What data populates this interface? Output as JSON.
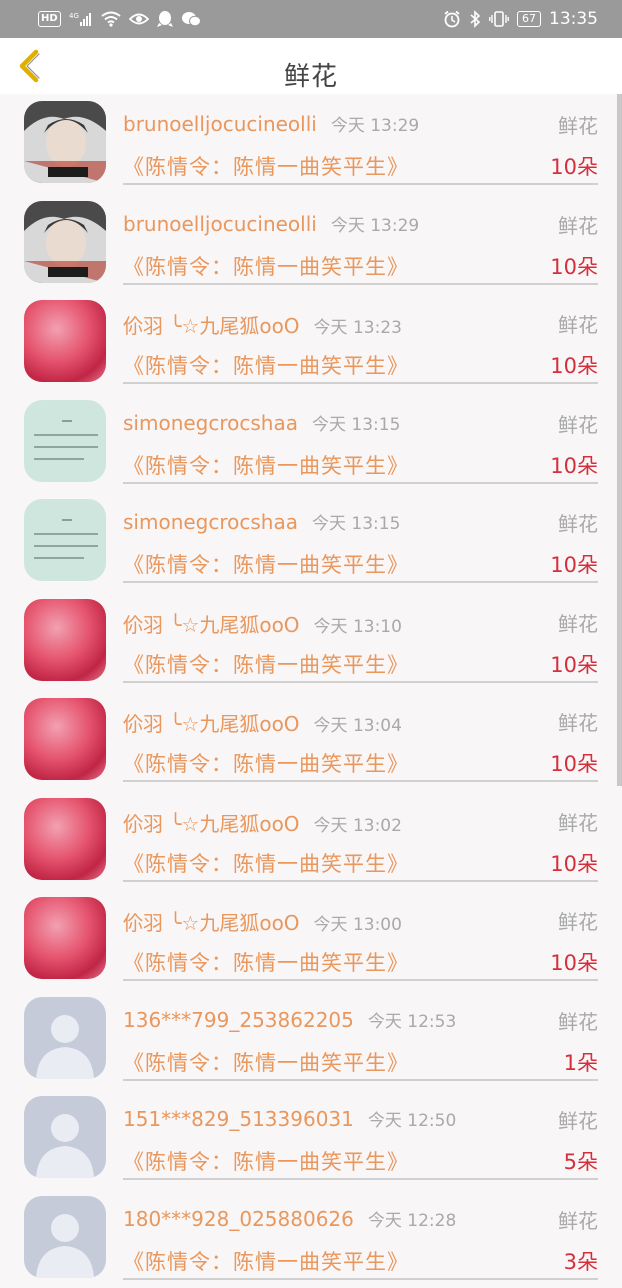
{
  "status_bar": {
    "hd": "HD",
    "network": "4G",
    "battery": "67",
    "time": "13:35"
  },
  "header": {
    "title": "鲜花"
  },
  "rows": [
    {
      "avatar": "photo-boy",
      "name": "brunoelljocucineolli",
      "time": "今天 13:29",
      "gift": "鲜花",
      "work": "《陈情令：陈情一曲笑平生》",
      "count": "10朵"
    },
    {
      "avatar": "photo-boy",
      "name": "brunoelljocucineolli",
      "time": "今天 13:29",
      "gift": "鲜花",
      "work": "《陈情令：陈情一曲笑平生》",
      "count": "10朵"
    },
    {
      "avatar": "pink-art",
      "name": "伱羽 ╰☆九尾狐ooO",
      "time": "今天 13:23",
      "gift": "鲜花",
      "work": "《陈情令：陈情一曲笑平生》",
      "count": "10朵"
    },
    {
      "avatar": "text-note",
      "name": "simonegcrocshaa",
      "time": "今天 13:15",
      "gift": "鲜花",
      "work": "《陈情令：陈情一曲笑平生》",
      "count": "10朵"
    },
    {
      "avatar": "text-note",
      "name": "simonegcrocshaa",
      "time": "今天 13:15",
      "gift": "鲜花",
      "work": "《陈情令：陈情一曲笑平生》",
      "count": "10朵"
    },
    {
      "avatar": "pink-art",
      "name": "伱羽 ╰☆九尾狐ooO",
      "time": "今天 13:10",
      "gift": "鲜花",
      "work": "《陈情令：陈情一曲笑平生》",
      "count": "10朵"
    },
    {
      "avatar": "pink-art",
      "name": "伱羽 ╰☆九尾狐ooO",
      "time": "今天 13:04",
      "gift": "鲜花",
      "work": "《陈情令：陈情一曲笑平生》",
      "count": "10朵"
    },
    {
      "avatar": "pink-art",
      "name": "伱羽 ╰☆九尾狐ooO",
      "time": "今天 13:02",
      "gift": "鲜花",
      "work": "《陈情令：陈情一曲笑平生》",
      "count": "10朵"
    },
    {
      "avatar": "pink-art",
      "name": "伱羽 ╰☆九尾狐ooO",
      "time": "今天 13:00",
      "gift": "鲜花",
      "work": "《陈情令：陈情一曲笑平生》",
      "count": "10朵"
    },
    {
      "avatar": "default-user",
      "name": "136***799_253862205",
      "time": "今天 12:53",
      "gift": "鲜花",
      "work": "《陈情令：陈情一曲笑平生》",
      "count": "1朵"
    },
    {
      "avatar": "default-user",
      "name": "151***829_513396031",
      "time": "今天 12:50",
      "gift": "鲜花",
      "work": "《陈情令：陈情一曲笑平生》",
      "count": "5朵"
    },
    {
      "avatar": "default-user",
      "name": "180***928_025880626",
      "time": "今天 12:28",
      "gift": "鲜花",
      "work": "《陈情令：陈情一曲笑平生》",
      "count": "3朵"
    }
  ],
  "colors": {
    "accent": "#e9975c",
    "count_red": "#d4303c",
    "back_arrow": "#e0b000"
  }
}
